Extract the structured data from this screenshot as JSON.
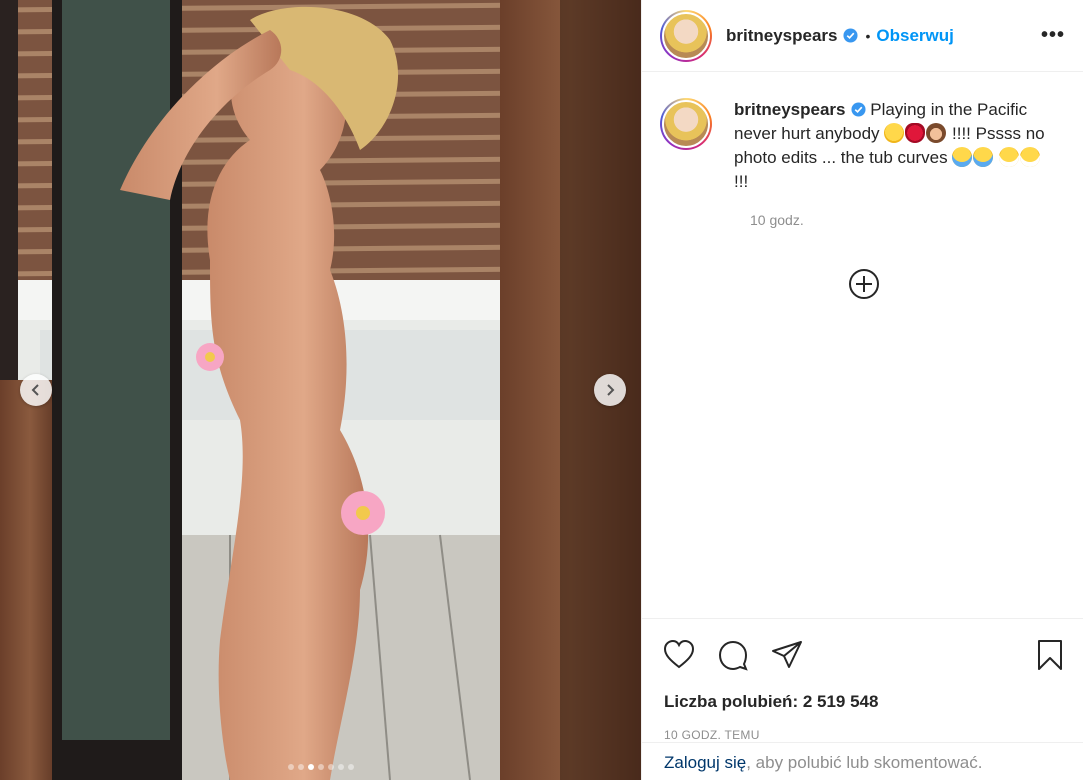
{
  "header": {
    "username": "britneyspears",
    "separator": "•",
    "follow_label": "Obserwuj",
    "more_label": "•••"
  },
  "caption": {
    "username": "britneyspears",
    "text_part1": "Playing in the Pacific never hurt anybody",
    "text_part2": "!!!! Pssss no photo edits ... the tub curves",
    "text_part3": "!!!",
    "emojis": [
      "winking-face",
      "kiss-mark",
      "see-no-evil-monkey",
      "face-with-tears-of-joy",
      "face-with-tears-of-joy",
      "grimacing-face",
      "grimacing-face"
    ]
  },
  "timestamp": "10 godz.",
  "actions": {
    "icons": [
      "heart-icon",
      "comment-icon",
      "share-icon",
      "bookmark-icon"
    ]
  },
  "likes_text": "Liczba polubień: 2 519 548",
  "time_ago": "10 GODZ. TEMU",
  "login_prompt": {
    "link": "Zaloguj się",
    "rest": ", aby polubić lub skomentować."
  },
  "carousel": {
    "slide_count": 7,
    "active_index": 2
  },
  "colors": {
    "accent": "#0095f6",
    "verified": "#3897f0",
    "text": "#262626",
    "muted": "#8e8e8e"
  }
}
